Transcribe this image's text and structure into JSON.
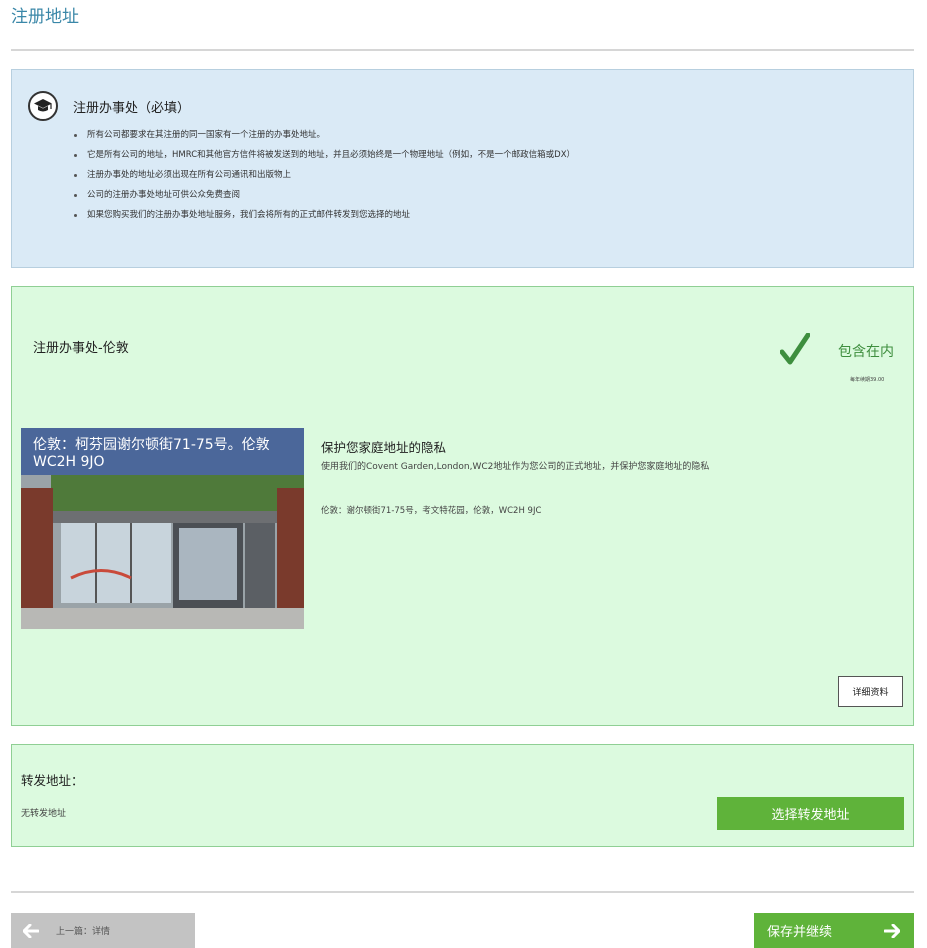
{
  "page": {
    "title": "注册地址"
  },
  "info": {
    "title": "注册办事处（必填）",
    "items": [
      "所有公司都要求在其注册的同一国家有一个注册的办事处地址。",
      "它是所有公司的地址，HMRC和其他官方信件将被发送到的地址，并且必须始终是一个物理地址（例如，不是一个邮政信箱或DX）",
      "注册办事处的地址必须出现在所有公司通讯和出版物上",
      "公司的注册办事处地址可供公众免费查阅",
      "如果您购买我们的注册办事处地址服务，我们会将所有的正式邮件转发到您选择的地址"
    ]
  },
  "office": {
    "title": "注册办事处-伦敦",
    "included_label": "包含在内",
    "yearly_fee": "每年续期39.00",
    "photo_caption": "伦敦：柯芬园谢尔顿街71-75号。伦敦 WC2H 9JO",
    "privacy_title": "保护您家庭地址的隐私",
    "privacy_text": "使用我们的Covent Garden,London,WC2地址作为您公司的正式地址，并保护您家庭地址的隐私",
    "address": "伦敦：谢尔顿街71-75号，考文特花园，伦敦，WC2H 9JC",
    "details_label": "详细资料"
  },
  "forwarding": {
    "title": "转发地址：",
    "status": "无转发地址",
    "select_label": "选择转发地址"
  },
  "nav": {
    "prev_label": "上一篇：详情",
    "next_label": "保存并继续"
  },
  "colors": {
    "accent_green": "#5fb33a",
    "info_bg": "#daeaf6",
    "success_bg": "#dcfadf",
    "title_blue": "#3a87a8"
  },
  "icons": {
    "info": "graduation-cap-icon",
    "included": "checkmark-icon",
    "prev": "arrow-left-icon",
    "next": "arrow-right-icon"
  }
}
